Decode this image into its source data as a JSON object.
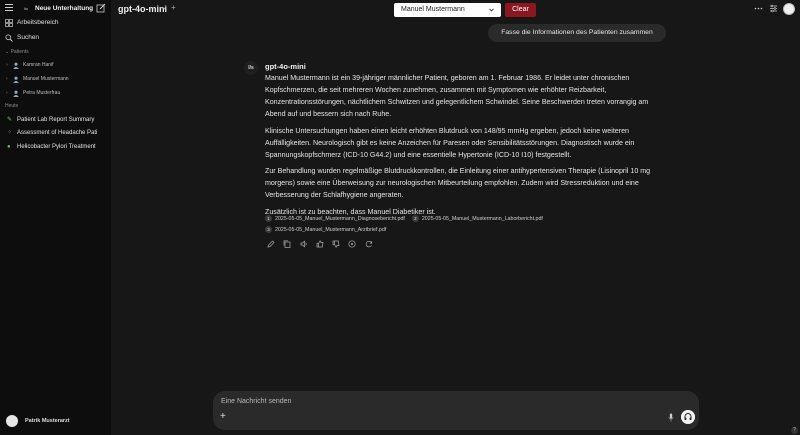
{
  "sidebar": {
    "new_chat": "Neue Unterhaltung",
    "logo_text": "Itu",
    "workspace": "Arbeitsbereich",
    "search": "Suchen",
    "patients_section": "Patients",
    "patients": [
      "Kamran Hanif",
      "Manuel Mustermann",
      "Petra Musterfrau"
    ],
    "today_section": "Heute",
    "chats": [
      {
        "icon": "pencil-icon",
        "label": "Patient Lab Report Summary"
      },
      {
        "icon": "sparkle-icon",
        "label": "Assessment of Headache Pati"
      },
      {
        "icon": "pill-icon",
        "label": "Helicobacter Pylori Treatment"
      }
    ],
    "user_name": "Patrik Musterarzt"
  },
  "header": {
    "model": "gpt-4o-mini",
    "patient_selected": "Manuel Mustermann",
    "clear_label": "Clear"
  },
  "chat": {
    "user_message": "Fasse die Informationen des Patienten zusammen",
    "assistant_avatar_text": "I/s",
    "assistant_name": "gpt-4o-mini",
    "paragraphs": [
      "Manuel Mustermann ist ein 39-jähriger männlicher Patient, geboren am 1. Februar 1986. Er leidet unter chronischen Kopfschmerzen, die seit mehreren Wochen zunehmen, zusammen mit Symptomen wie erhöhter Reizbarkeit, Konzentrationsstörungen, nächtlichem Schwitzen und gelegentlichem Schwindel. Seine Beschwerden treten vorrangig am Abend auf und bessern sich nach Ruhe.",
      "Klinische Untersuchungen haben einen leicht erhöhten Blutdruck von 148/95 mmHg ergeben, jedoch keine weiteren Auffälligkeiten. Neurologisch gibt es keine Anzeichen für Paresen oder Sensibilitätsstörungen. Diagnostisch wurde ein Spannungskopfschmerz (ICD-10 G44.2) und eine essentielle Hypertonie (ICD-10 I10) festgestellt.",
      "Zur Behandlung wurden regelmäßige Blutdruckkontrollen, die Einleitung einer antihypertensiven Therapie (Lisinopril 10 mg morgens) sowie eine Überweisung zur neurologischen Mitbeurteilung empfohlen. Zudem wird Stressreduktion und eine Verbesserung der Schlafhygiene angeraten.",
      "Zusätzlich ist zu beachten, dass Manuel Diabetiker ist."
    ],
    "sources": [
      {
        "num": "1",
        "file": "2025-05-05_Manuel_Mustermann_Diagnosebericht.pdf"
      },
      {
        "num": "2",
        "file": "2025-05-05_Manuel_Mustermann_Laborbericht.pdf"
      },
      {
        "num": "3",
        "file": "2025-05-05_Manuel_Mustermann_Arztbrief.pdf"
      }
    ],
    "actions": [
      "edit-icon",
      "copy-icon",
      "speaker-icon",
      "thumbs-up-icon",
      "thumbs-down-icon",
      "info-icon",
      "regenerate-icon"
    ]
  },
  "composer": {
    "placeholder": "Eine Nachricht senden"
  },
  "help_label": "?"
}
